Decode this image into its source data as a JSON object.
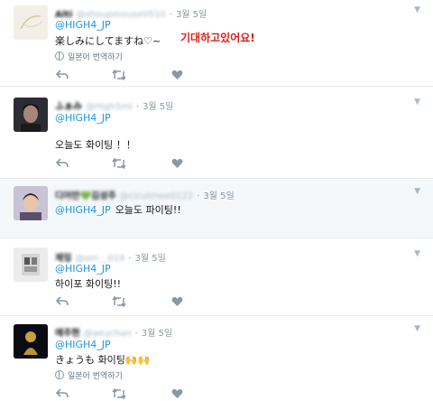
{
  "tweets": [
    {
      "name": "Alti",
      "handle": "@shoupmouse0510",
      "date": "3월 5일",
      "mention": "@HIGH4_JP",
      "text": "楽しみにしてますね♡~",
      "translate": "일본어 번역하기"
    },
    {
      "name": "ふぁみ",
      "handle": "@High5mi",
      "date": "3월 5일",
      "mention": "@HIGH4_JP",
      "text": "오늘도 화이팅 ！！"
    },
    {
      "name": "디어만💚김성주",
      "handle": "@cicutmee0122",
      "date": "3월 5일",
      "mention": "@HIGH4_JP",
      "inline_text": "오늘도 파이팅!!"
    },
    {
      "name": "제밍",
      "handle": "@om__019",
      "date": "3월 5일",
      "mention": "@HIGH4_JP",
      "text": "하이포 화이팅!!"
    },
    {
      "name": "예주현",
      "handle": "@aeuchan",
      "date": "3월 5일",
      "mention": "@HIGH4_JP",
      "text": "きょうも 화이팅🙌🙌",
      "translate": "일본어 번역하기"
    }
  ],
  "annotation": "기대하고있어요!",
  "icons": [
    "reply-icon",
    "retweet-icon",
    "like-icon",
    "chevron-down-icon",
    "globe-icon"
  ],
  "colors": {
    "link": "#1b95e0",
    "muted": "#8899a6",
    "annotation": "#e0201a",
    "highlight_bg": "#f5f8fa"
  }
}
